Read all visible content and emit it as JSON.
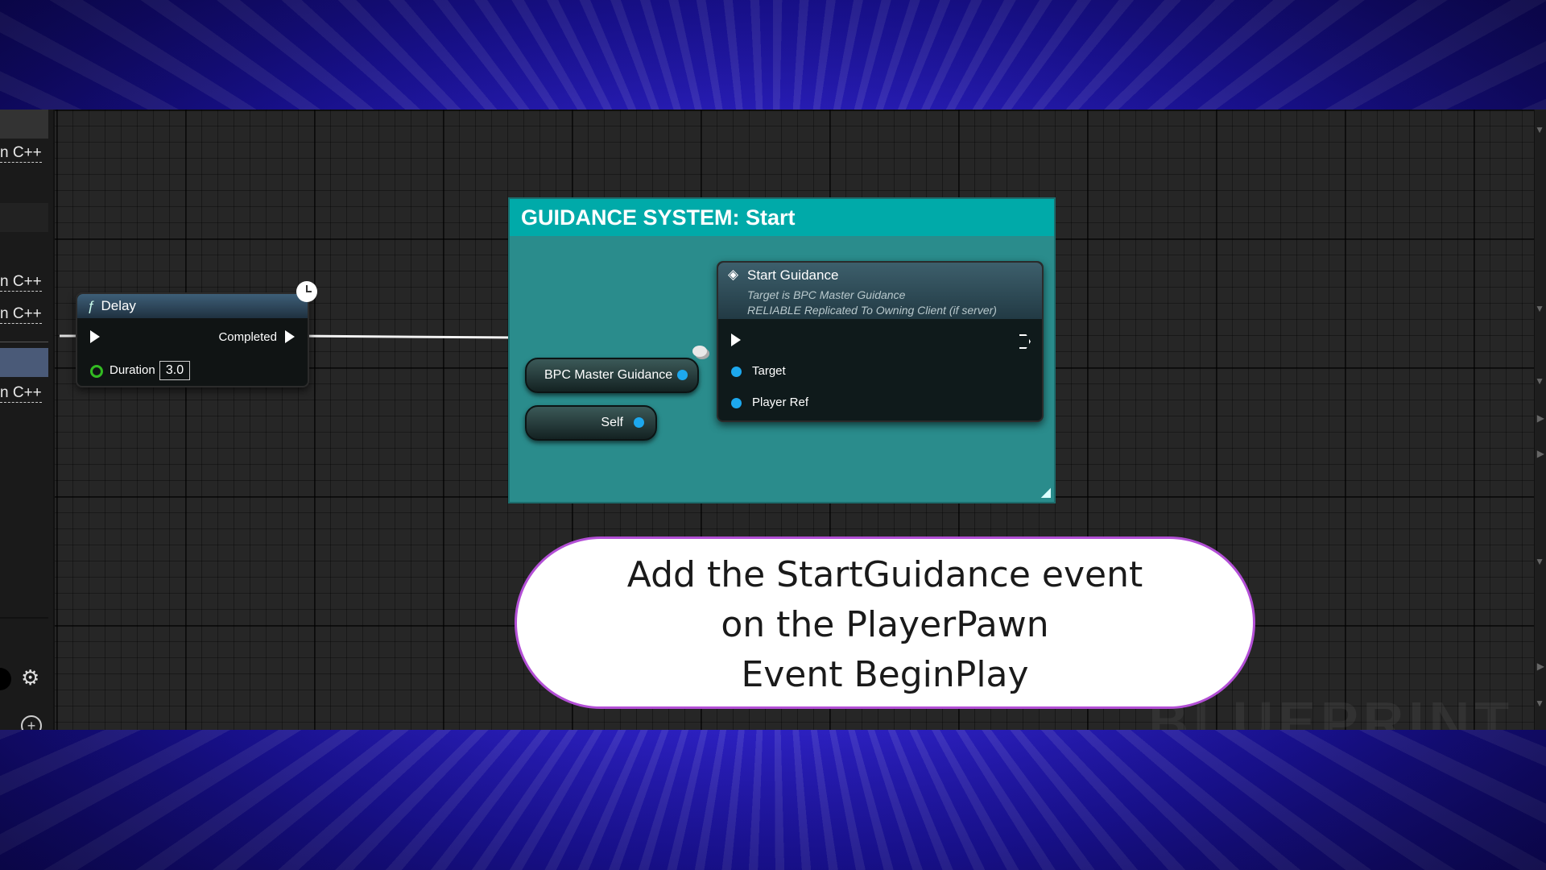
{
  "left_panel": {
    "rows": [
      "n C++",
      "n C++",
      "n C++",
      "n C++"
    ]
  },
  "comment": {
    "title": "GUIDANCE SYSTEM: Start"
  },
  "delay_node": {
    "title": "Delay",
    "completed_label": "Completed",
    "duration_label": "Duration",
    "duration_value": "3.0"
  },
  "start_guidance_node": {
    "title": "Start Guidance",
    "subtitle_line1": "Target is BPC Master Guidance",
    "subtitle_line2": "RELIABLE Replicated To Owning Client (if server)",
    "target_label": "Target",
    "player_ref_label": "Player Ref"
  },
  "bpc_node": {
    "label": "BPC Master Guidance"
  },
  "self_node": {
    "label": "Self"
  },
  "caption": {
    "line1": "Add the StartGuidance event",
    "line2": "on the PlayerPawn",
    "line3": "Event BeginPlay"
  },
  "watermark": "BLUEPRINT",
  "colors": {
    "comment_header": "#00aaa9",
    "comment_body": "#2a8c8c",
    "data_pin": "#1da8ee",
    "caption_border": "#b34fd6"
  },
  "icons": [
    "function-icon",
    "clock-icon",
    "event-icon",
    "gear-icon",
    "add-icon",
    "resize-icon"
  ]
}
